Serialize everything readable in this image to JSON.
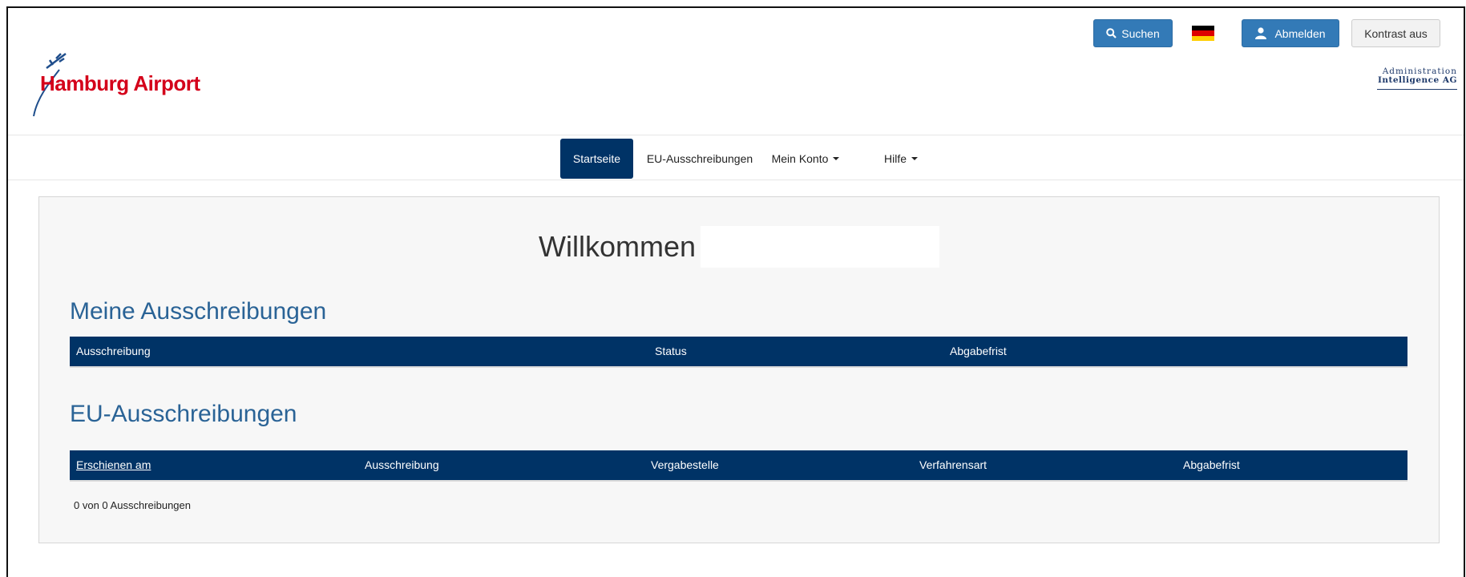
{
  "header": {
    "logo_text": "Hamburg Airport",
    "search_label": "Suchen",
    "logout_label": "Abmelden",
    "contrast_label": "Kontrast aus",
    "partner_logo_line1": "Administration",
    "partner_logo_line2": "Intelligence AG",
    "flag": {
      "colors": [
        "#000000",
        "#dd0000",
        "#ffce00"
      ]
    }
  },
  "nav": {
    "items": [
      {
        "label": "Startseite",
        "active": true
      },
      {
        "label": "EU-Ausschreibungen",
        "active": false
      },
      {
        "label": "Mein Konto",
        "dropdown": true
      },
      {
        "label": "Hilfe",
        "dropdown": true
      }
    ]
  },
  "main": {
    "welcome": "Willkommen",
    "my_tenders": {
      "title": "Meine Ausschreibungen",
      "columns": [
        "Ausschreibung",
        "Status",
        "Abgabefrist"
      ]
    },
    "eu_tenders": {
      "title": "EU-Ausschreibungen",
      "columns": [
        "Erschienen am",
        "Ausschreibung",
        "Vergabestelle",
        "Verfahrensart",
        "Abgabefrist"
      ],
      "count_text": "0 von 0 Ausschreibungen"
    }
  },
  "colors": {
    "primary": "#337ab7",
    "nav_active": "#003366",
    "table_header": "#003366",
    "heading": "#2a6396",
    "brand_red": "#d4001a"
  }
}
